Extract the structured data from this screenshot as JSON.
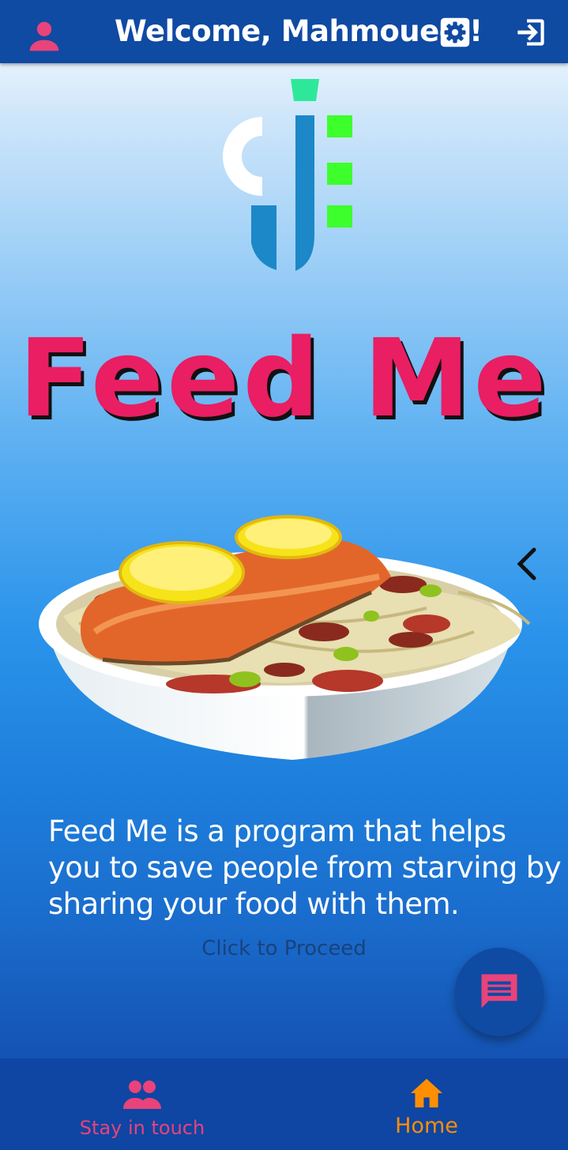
{
  "header": {
    "title": "Welcome, Mahmoued !",
    "icons": [
      "person-icon",
      "settings-icon",
      "logout-icon"
    ],
    "background": "#0f4aa3"
  },
  "hero": {
    "title": "Feed Me",
    "title_color": "#e91e63"
  },
  "description": "Feed Me is a program that helps you to save people from starving by sharing your food with them.",
  "proceed_label": "Click to Proceed",
  "fab": {
    "icon": "chat-icon",
    "icon_color": "#e8437a"
  },
  "bottom_nav": {
    "items": [
      {
        "label": "Stay in touch",
        "icon": "people-icon",
        "color": "#e8437a"
      },
      {
        "label": "Home",
        "icon": "home-icon",
        "color": "#ff8f00",
        "active": true
      }
    ]
  }
}
